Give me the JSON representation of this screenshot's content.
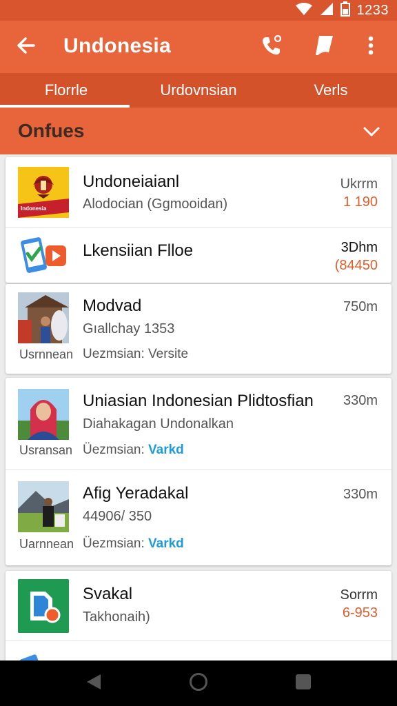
{
  "status_bar": {
    "time": "1233"
  },
  "app_bar": {
    "title": "Undonesia"
  },
  "tabs": [
    {
      "label": "Florrle"
    },
    {
      "label": "Urdovnsian"
    },
    {
      "label": "Verls"
    }
  ],
  "filter": {
    "label": "Onfues"
  },
  "items": [
    {
      "title": "Undoneiaianl",
      "subtitle": "Alodocian (Ggmooidan)",
      "right_top": "Ukrrm",
      "right_bottom": "1 190",
      "badge_text": "Indonesia"
    },
    {
      "title": "Lkensiian Flloe",
      "right_top": "3Dhm",
      "right_bottom": "(84450"
    },
    {
      "title": "Modvad",
      "subtitle": "Gıallchay 1353",
      "meta_label": "Usrnnean",
      "meta_prefix": "Uezmsian:",
      "meta_value": "Versite",
      "right_top": "750m"
    },
    {
      "title": "Uniasian Indonesian Plidtosfian",
      "subtitle": "Diahakagan Undonalkan",
      "meta_label": "Usransan",
      "meta_prefix": "Üezmsian:",
      "meta_value": "Varkd",
      "right_top": "330m"
    },
    {
      "title": "Afig Yeradakal",
      "subtitle": "44906/ 350",
      "meta_label": "Uarnnean",
      "meta_prefix": "Üezmsian:",
      "meta_value": "Varkd",
      "right_top": "330m"
    },
    {
      "title": "Svakal",
      "subtitle": "Takhonaih)",
      "right_top": "Sorrm",
      "right_bottom": "6-953"
    }
  ],
  "colors": {
    "primary": "#e8643a",
    "primary_dark": "#d4522a",
    "link": "#1e9bd7",
    "accent_text": "#e25c2b"
  },
  "icons": [
    "wifi-icon",
    "signal-icon",
    "battery-icon",
    "back-arrow-icon",
    "phone-icon",
    "bookmark-icon",
    "more-vert-icon",
    "chevron-down-icon",
    "nav-back-icon",
    "nav-home-icon",
    "nav-recents-icon"
  ]
}
